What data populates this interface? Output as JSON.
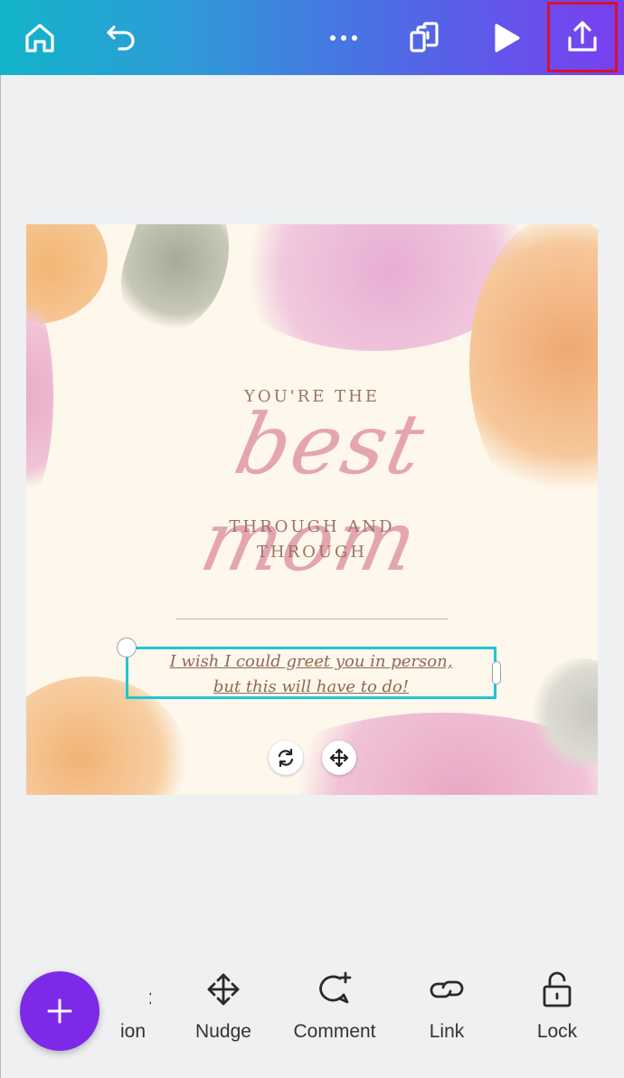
{
  "topbar": {
    "icons": [
      "home-icon",
      "undo-icon",
      "more-icon",
      "pages-icon",
      "play-icon",
      "share-icon"
    ]
  },
  "design": {
    "line1": "YOU'RE THE",
    "script_text": "best mom",
    "line2": "THROUGH AND",
    "line3": "THROUGH",
    "selected_text_line1": "I wish I could greet you in person,",
    "selected_text_line2": "but this will have to do!"
  },
  "toolbar": {
    "partial_label": "ion",
    "nudge_label": "Nudge",
    "comment_label": "Comment",
    "link_label": "Link",
    "lock_label": "Lock"
  },
  "colors": {
    "accent": "#7d2ae8",
    "selection": "#1fc6d2",
    "highlight": "#d3142c"
  }
}
